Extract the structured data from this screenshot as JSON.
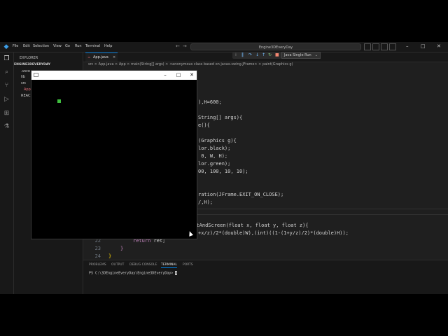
{
  "window": {
    "search_title": "Engine3DEveryDay"
  },
  "menu": [
    "File",
    "Edit",
    "Selection",
    "View",
    "Go",
    "Run",
    "Terminal",
    "Help"
  ],
  "explorer": {
    "header": "EXPLORER",
    "root": "ENGINE3DEVERYDAY",
    "items": [
      ".vscode",
      "lib",
      "src",
      "App.java",
      "README.md"
    ],
    "items_visible": [
      ".vsco",
      "lib",
      "src",
      "App",
      "REAC"
    ]
  },
  "editor": {
    "tab_label": "App.java",
    "tab_close": "×",
    "breadcrumb": "src > App.java > App > main(String[] args) > <anonymous class based on javax.swing.JFrame> > paint(Graphics g)",
    "run_config": "Java Single Run",
    "code": {
      "l1": "),H=600;",
      "l2": "String[] args){",
      "l3": "e(){",
      "l4": "(Graphics g){",
      "l5": "lor.black);",
      "l6": " 0, W, H);",
      "l7": "lor.green);",
      "l8": "00, 100, 10, 10);",
      "l9": "ration(JFrame.EXIT_ON_CLOSE);",
      "l10": "/,H);",
      "l11": "ectAndScreen(float x, float y, float z){",
      "l12": "+x/z)/2*(double)W),(int)((1-(1+y/z)/2)*(double)H));",
      "l13_kw": "return",
      "l13_rest": " ret;",
      "l14": "}",
      "l15": "}"
    },
    "line_numbers": [
      "22",
      "23",
      "24"
    ]
  },
  "panel": {
    "tabs": [
      "PROBLEMS",
      "OUTPUT",
      "DEBUG CONSOLE",
      "TERMINAL",
      "PORTS"
    ],
    "terminal_prompt": "PS C:\\3DEngineEveryDay\\Engine3DEveryDay> "
  },
  "java_window": {
    "minimize": "–",
    "maximize": "□",
    "close": "✕",
    "square_color": "#3fbf3f"
  },
  "colors": {
    "accent": "#0078d4",
    "background": "#1f1f1f"
  }
}
